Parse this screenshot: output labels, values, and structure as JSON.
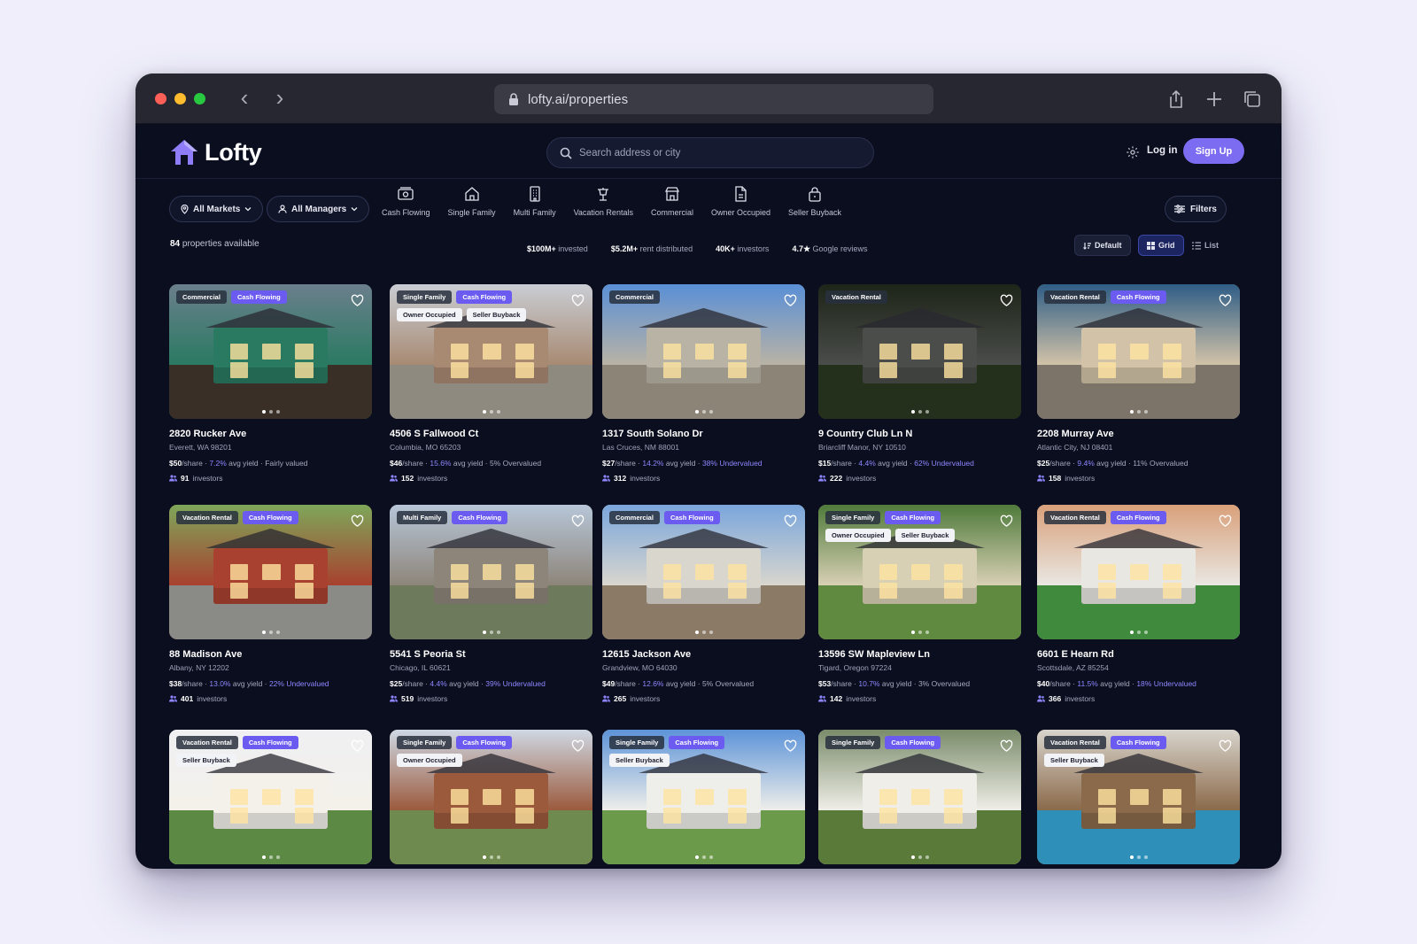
{
  "browser": {
    "url": "lofty.ai/properties"
  },
  "header": {
    "logo_text": "Lofty",
    "search_placeholder": "Search address or city",
    "login_label": "Log in",
    "signup_label": "Sign Up"
  },
  "filters": {
    "markets_label": "All Markets",
    "managers_label": "All Managers",
    "categories": [
      {
        "label": "Cash Flowing",
        "icon": "cash-icon"
      },
      {
        "label": "Single Family",
        "icon": "house-icon"
      },
      {
        "label": "Multi Family",
        "icon": "building-icon"
      },
      {
        "label": "Vacation Rentals",
        "icon": "umbrella-icon"
      },
      {
        "label": "Commercial",
        "icon": "store-icon"
      },
      {
        "label": "Owner Occupied",
        "icon": "document-icon"
      },
      {
        "label": "Seller Buyback",
        "icon": "lock-bag-icon"
      }
    ],
    "filters_label": "Filters"
  },
  "summary": {
    "count": "84",
    "count_suffix": "properties available",
    "stats": [
      {
        "value": "$100M+",
        "label": "invested"
      },
      {
        "value": "$5.2M+",
        "label": "rent distributed"
      },
      {
        "value": "40K+",
        "label": "investors"
      },
      {
        "value": "4.7★",
        "label": "Google reviews"
      }
    ],
    "sort_label": "Default",
    "grid_label": "Grid",
    "list_label": "List"
  },
  "properties": [
    {
      "address": "2820 Rucker Ave",
      "city": "Everett, WA 98201",
      "price": "$50",
      "yield": "7.2%",
      "valuation": "Fairly valued",
      "val_type": "neutral",
      "investors": "91",
      "tags": [
        [
          "Commercial",
          "dark"
        ],
        [
          "Cash Flowing",
          "purple"
        ]
      ],
      "palette": [
        "#6b7f8c",
        "#3a2f26",
        "#2a7a62"
      ]
    },
    {
      "address": "4506 S Fallwood Ct",
      "city": "Columbia, MO 65203",
      "price": "$46",
      "yield": "15.6%",
      "valuation": "5% Overvalued",
      "val_type": "neutral",
      "investors": "152",
      "tags": [
        [
          "Single Family",
          "dark"
        ],
        [
          "Cash Flowing",
          "purple"
        ],
        [
          "Owner Occupied",
          "light"
        ],
        [
          "Seller Buyback",
          "light"
        ]
      ],
      "palette": [
        "#c9cdd4",
        "#8f8a80",
        "#a88a72"
      ]
    },
    {
      "address": "1317 South Solano Dr",
      "city": "Las Cruces, NM 88001",
      "price": "$27",
      "yield": "14.2%",
      "valuation": "38% Undervalued",
      "val_type": "under",
      "investors": "312",
      "tags": [
        [
          "Commercial",
          "dark"
        ]
      ],
      "palette": [
        "#5a8fd6",
        "#8c8577",
        "#b9b3a5"
      ]
    },
    {
      "address": "9 Country Club Ln N",
      "city": "Briarcliff Manor, NY 10510",
      "price": "$15",
      "yield": "4.4%",
      "valuation": "62% Undervalued",
      "val_type": "under",
      "investors": "222",
      "tags": [
        [
          "Vacation Rental",
          "dark"
        ]
      ],
      "palette": [
        "#1d2418",
        "#24301c",
        "#4a4d4a"
      ]
    },
    {
      "address": "2208 Murray Ave",
      "city": "Atlantic City, NJ 08401",
      "price": "$25",
      "yield": "9.4%",
      "valuation": "11% Overvalued",
      "val_type": "neutral",
      "investors": "158",
      "tags": [
        [
          "Vacation Rental",
          "dark"
        ],
        [
          "Cash Flowing",
          "purple"
        ]
      ],
      "palette": [
        "#2f5d86",
        "#7c7468",
        "#d2c3a8"
      ]
    },
    {
      "address": "88 Madison Ave",
      "city": "Albany, NY 12202",
      "price": "$38",
      "yield": "13.0%",
      "valuation": "22% Undervalued",
      "val_type": "under",
      "investors": "401",
      "tags": [
        [
          "Vacation Rental",
          "dark"
        ],
        [
          "Cash Flowing",
          "purple"
        ]
      ],
      "palette": [
        "#7ea75a",
        "#8a8a86",
        "#a8412f"
      ]
    },
    {
      "address": "5541 S Peoria St",
      "city": "Chicago, IL 60621",
      "price": "$25",
      "yield": "4.4%",
      "valuation": "39% Undervalued",
      "val_type": "under",
      "investors": "519",
      "tags": [
        [
          "Multi Family",
          "dark"
        ],
        [
          "Cash Flowing",
          "purple"
        ]
      ],
      "palette": [
        "#b7c6d8",
        "#6d7a5c",
        "#8d857a"
      ]
    },
    {
      "address": "12615 Jackson Ave",
      "city": "Grandview, MO 64030",
      "price": "$49",
      "yield": "12.6%",
      "valuation": "5% Overvalued",
      "val_type": "neutral",
      "investors": "265",
      "tags": [
        [
          "Commercial",
          "dark"
        ],
        [
          "Cash Flowing",
          "purple"
        ]
      ],
      "palette": [
        "#7aa6dc",
        "#8a7a66",
        "#d9d6ce"
      ]
    },
    {
      "address": "13596 SW Mapleview Ln",
      "city": "Tigard, Oregon 97224",
      "price": "$53",
      "yield": "10.7%",
      "valuation": "3% Overvalued",
      "val_type": "neutral",
      "investors": "142",
      "tags": [
        [
          "Single Family",
          "dark"
        ],
        [
          "Cash Flowing",
          "purple"
        ],
        [
          "Owner Occupied",
          "light"
        ],
        [
          "Seller Buyback",
          "light"
        ]
      ],
      "palette": [
        "#4f7a3a",
        "#5f8a3f",
        "#d8d0b4"
      ]
    },
    {
      "address": "6601 E Hearn Rd",
      "city": "Scottsdale, AZ 85254",
      "price": "$40",
      "yield": "11.5%",
      "valuation": "18% Undervalued",
      "val_type": "under",
      "investors": "366",
      "tags": [
        [
          "Vacation Rental",
          "dark"
        ],
        [
          "Cash Flowing",
          "purple"
        ]
      ],
      "palette": [
        "#d9a07a",
        "#3f8a3c",
        "#e9e7e2"
      ]
    },
    {
      "tags": [
        [
          "Vacation Rental",
          "dark"
        ],
        [
          "Cash Flowing",
          "purple"
        ],
        [
          "Seller Buyback",
          "light"
        ]
      ],
      "palette": [
        "#f0f0f2",
        "#5c8a44",
        "#f4f1ea"
      ]
    },
    {
      "tags": [
        [
          "Single Family",
          "dark"
        ],
        [
          "Cash Flowing",
          "purple"
        ],
        [
          "Owner Occupied",
          "light"
        ]
      ],
      "palette": [
        "#cfd8e4",
        "#6f8a4e",
        "#9b5a3c"
      ]
    },
    {
      "tags": [
        [
          "Single Family",
          "dark"
        ],
        [
          "Cash Flowing",
          "purple"
        ],
        [
          "Seller Buyback",
          "light"
        ]
      ],
      "palette": [
        "#5d93d8",
        "#6a9a4a",
        "#eeeeea"
      ]
    },
    {
      "tags": [
        [
          "Single Family",
          "dark"
        ],
        [
          "Cash Flowing",
          "purple"
        ]
      ],
      "palette": [
        "#7a8c6a",
        "#5a7a3a",
        "#f0eee8"
      ]
    },
    {
      "tags": [
        [
          "Vacation Rental",
          "dark"
        ],
        [
          "Cash Flowing",
          "purple"
        ],
        [
          "Seller Buyback",
          "light"
        ]
      ],
      "palette": [
        "#d8d4cc",
        "#2e8fb8",
        "#8a6a4a"
      ]
    }
  ],
  "labels": {
    "per_share": "/share",
    "avg_yield": "avg yield",
    "investors_suffix": "investors"
  }
}
